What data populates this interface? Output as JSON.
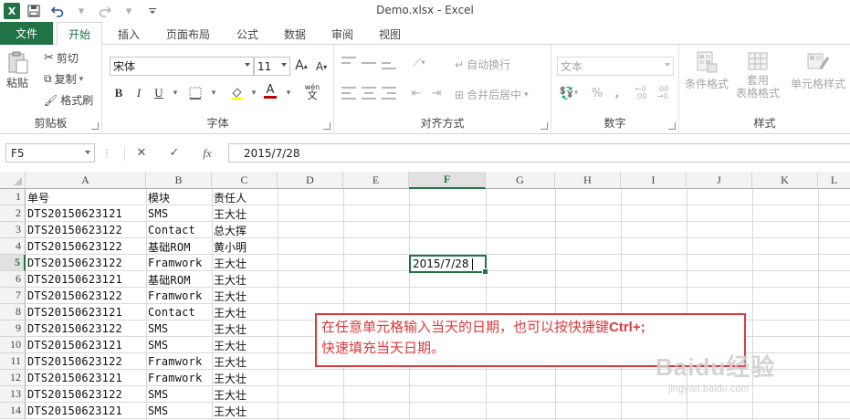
{
  "window": {
    "title": "Demo.xlsx - Excel"
  },
  "qat": {
    "app_icon": "X",
    "icons": [
      "excel-logo-icon",
      "save-icon",
      "undo-icon",
      "redo-icon",
      "customize-qat-icon"
    ]
  },
  "tabs": [
    {
      "label": "文件",
      "active": false
    },
    {
      "label": "开始",
      "active": true
    },
    {
      "label": "插入",
      "active": false
    },
    {
      "label": "页面布局",
      "active": false
    },
    {
      "label": "公式",
      "active": false
    },
    {
      "label": "数据",
      "active": false
    },
    {
      "label": "审阅",
      "active": false
    },
    {
      "label": "视图",
      "active": false
    }
  ],
  "ribbon": {
    "clipboard": {
      "label": "剪贴板",
      "paste": "粘贴",
      "cut": "剪切",
      "copy": "复制",
      "format_painter": "格式刷"
    },
    "font": {
      "label": "字体",
      "font_name": "宋体",
      "font_size": "11",
      "grow": "A",
      "shrink": "A",
      "bold": "B",
      "italic": "I",
      "underline": "U",
      "font_color": "A",
      "phonetic": "wén"
    },
    "alignment": {
      "label": "对齐方式",
      "wrap_text": "自动换行",
      "merge_center": "合并后居中"
    },
    "number": {
      "label": "数字",
      "format": "文本",
      "percent": "%",
      "comma": ","
    },
    "styles": {
      "label": "样式",
      "conditional": "条件格式",
      "table_format_line1": "套用",
      "table_format_line2": "表格格式",
      "cell_styles": "单元格样式"
    }
  },
  "formula_bar": {
    "name_box": "F5",
    "value": "2015/7/28",
    "fx": "fx"
  },
  "columns": [
    "A",
    "B",
    "C",
    "D",
    "E",
    "F",
    "G",
    "H",
    "I",
    "J",
    "K",
    "L"
  ],
  "selected_column": "F",
  "selected_row": "5",
  "rows": [
    {
      "n": "1",
      "a": "单号",
      "b": "模块",
      "c": "责任人"
    },
    {
      "n": "2",
      "a": "DTS20150623121",
      "b": "SMS",
      "c": "王大壮"
    },
    {
      "n": "3",
      "a": "DTS20150623122",
      "b": "Contact",
      "c": "总大挥"
    },
    {
      "n": "4",
      "a": "DTS20150623122",
      "b": "基础ROM",
      "c": "黄小明"
    },
    {
      "n": "5",
      "a": "DTS20150623122",
      "b": "Framwork",
      "c": "王大壮"
    },
    {
      "n": "6",
      "a": "DTS20150623121",
      "b": "基础ROM",
      "c": "王大壮"
    },
    {
      "n": "7",
      "a": "DTS20150623122",
      "b": "Framwork",
      "c": "王大壮"
    },
    {
      "n": "8",
      "a": "DTS20150623121",
      "b": "Contact",
      "c": "王大壮"
    },
    {
      "n": "9",
      "a": "DTS20150623122",
      "b": "SMS",
      "c": "王大壮"
    },
    {
      "n": "10",
      "a": "DTS20150623121",
      "b": "SMS",
      "c": "王大壮"
    },
    {
      "n": "11",
      "a": "DTS20150623122",
      "b": "Framwork",
      "c": "王大壮"
    },
    {
      "n": "12",
      "a": "DTS20150623121",
      "b": "Framwork",
      "c": "王大壮"
    },
    {
      "n": "13",
      "a": "DTS20150623122",
      "b": "SMS",
      "c": "王大壮"
    },
    {
      "n": "14",
      "a": "DTS20150623121",
      "b": "SMS",
      "c": "王大壮"
    }
  ],
  "active_cell": {
    "value": "2015/7/28"
  },
  "callout": {
    "line1_prefix": "在任意单元格输入当天的日期，也可以按快捷键",
    "shortcut": "Ctrl+;",
    "line2": "快速填充当天日期。"
  },
  "watermark": {
    "brand": "Baidu经验",
    "url": "jingyan.baidu.com"
  },
  "colors": {
    "accent": "#217346",
    "callout": "#e0393e",
    "font_red": "#c00000"
  }
}
